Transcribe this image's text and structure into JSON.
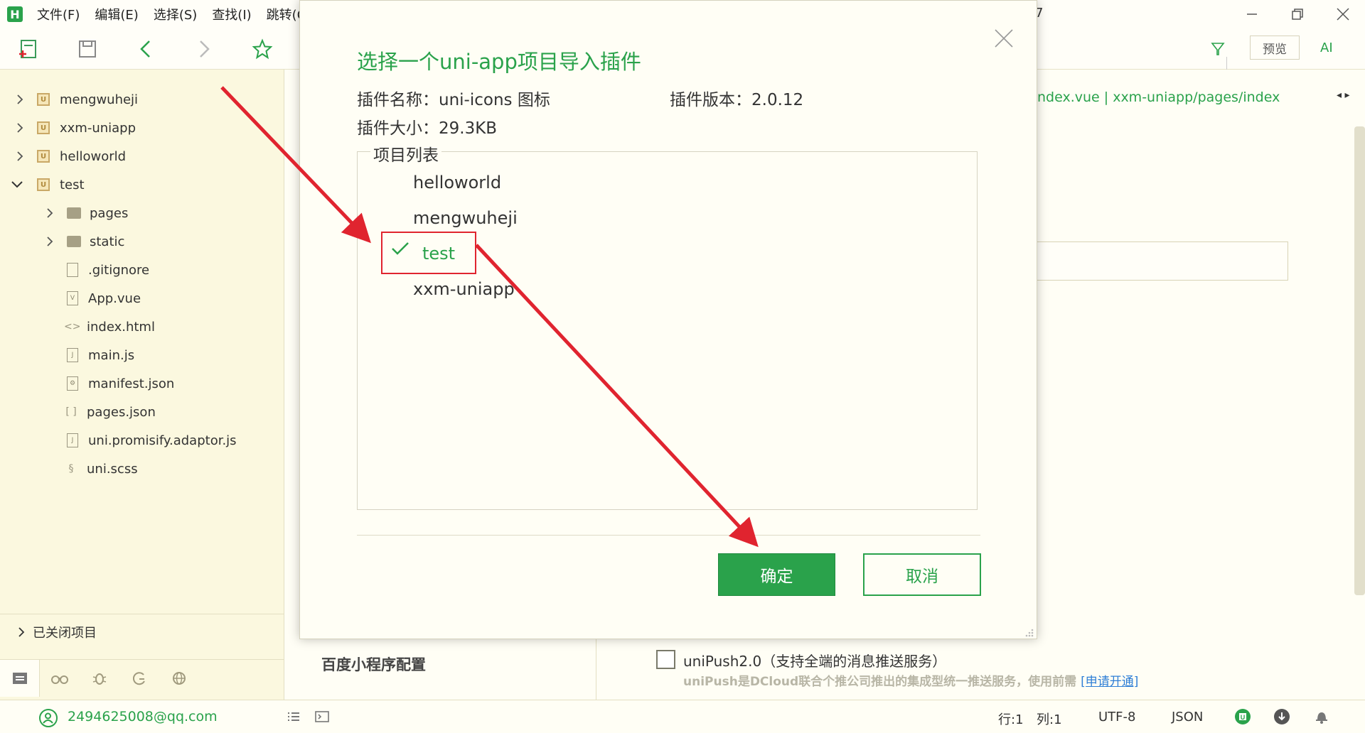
{
  "menubar": {
    "logo": "H",
    "items": [
      "文件(F)",
      "编辑(E)",
      "选择(S)",
      "查找(I)",
      "跳转(G"
    ],
    "title_fragment": "7"
  },
  "toolbar": {
    "preview_label": "预览",
    "ai_label": "AI"
  },
  "sidebar": {
    "projects": [
      {
        "label": "mengwuheji"
      },
      {
        "label": "xxm-uniapp"
      },
      {
        "label": "helloworld"
      },
      {
        "label": "test"
      }
    ],
    "test_children": [
      {
        "label": "pages",
        "kind": "folder"
      },
      {
        "label": "static",
        "kind": "folder"
      },
      {
        "label": ".gitignore",
        "kind": "file"
      },
      {
        "label": "App.vue",
        "kind": "vue"
      },
      {
        "label": "index.html",
        "kind": "html"
      },
      {
        "label": "main.js",
        "kind": "js"
      },
      {
        "label": "manifest.json",
        "kind": "manifest"
      },
      {
        "label": "pages.json",
        "kind": "json"
      },
      {
        "label": "uni.promisify.adaptor.js",
        "kind": "js"
      },
      {
        "label": "uni.scss",
        "kind": "scss"
      }
    ],
    "closed_projects_label": "已关闭项目"
  },
  "editor": {
    "breadcrumb": "ndex.vue | xxm-uniapp/pages/index",
    "baidu_config": "百度小程序配置",
    "unipush_label": "uniPush2.0（支持全端的消息推送服务）",
    "unipush_desc": "uniPush是DCloud联合个推公司推出的集成型统一推送服务，使用前需",
    "unipush_link": "[申请开通]"
  },
  "modal": {
    "title": "选择一个uni-app项目导入插件",
    "plugin_name_label": "插件名称：uni-icons 图标",
    "plugin_version_label": "插件版本：2.0.12",
    "plugin_size_label": "插件大小：29.3KB",
    "project_list_label": "项目列表",
    "projects": [
      "helloworld",
      "mengwuheji",
      "test",
      "xxm-uniapp"
    ],
    "selected_project": "test",
    "ok_label": "确定",
    "cancel_label": "取消"
  },
  "statusbar": {
    "user_email": "2494625008@qq.com",
    "line": "行:1",
    "column": "列:1",
    "encoding": "UTF-8",
    "language": "JSON"
  },
  "colors": {
    "accent_green": "#2aa24b",
    "annotation_red": "#e0242f",
    "link_blue": "#2f7fd6"
  }
}
